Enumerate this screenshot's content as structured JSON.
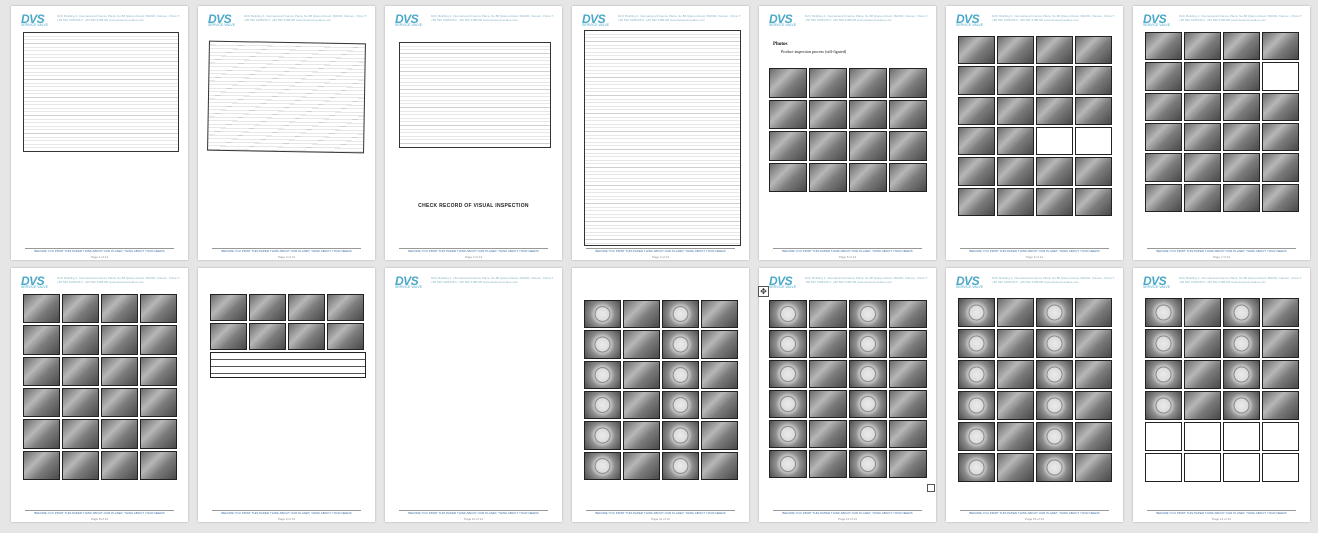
{
  "header": {
    "logo": "DVS",
    "logo_sub": "SERVICE VALVE",
    "address": "D20, Building 4, International Finance Plaza, No.88 Qianpu Road, 362000, Xiamen, China  T: +86 592 3185136  F: +86 592 3185135  www.dvsservicevalve.com"
  },
  "footer": {
    "text": "BEFORE YOU PRINT THIS PAPER THINK ABOUT OUR PLANET, THINK ABOUT YOUR NEEDS"
  },
  "pages": [
    {
      "page_label": "Page 1 of 14"
    },
    {
      "page_label": "Page 2 of 14"
    },
    {
      "page_label": "Page 3 of 14",
      "caption": "CHECK RECORD OF VISUAL INSPECTION"
    },
    {
      "page_label": "Page 4 of 14"
    },
    {
      "page_label": "Page 5 of 14",
      "photos_title": "Photos",
      "photos_bullet": "Product inspection process (self-figured)"
    },
    {
      "page_label": "Page 6 of 14"
    },
    {
      "page_label": "Page 7 of 14"
    },
    {
      "page_label": "Page 8 of 14"
    },
    {
      "page_label": "Page 9 of 14"
    },
    {
      "page_label": "Page 10 of 14"
    },
    {
      "page_label": "Page 11 of 14"
    },
    {
      "page_label": "Page 12 of 14"
    },
    {
      "page_label": "Page 13 of 14"
    },
    {
      "page_label": "Page 14 of 14"
    }
  ],
  "icons": {
    "move_handle": "move-icon",
    "checkbox": "checkbox-icon"
  },
  "colors": {
    "brand": "#4aa8c8",
    "background": "#e6e6e6",
    "footer_text": "#3c70a8"
  }
}
